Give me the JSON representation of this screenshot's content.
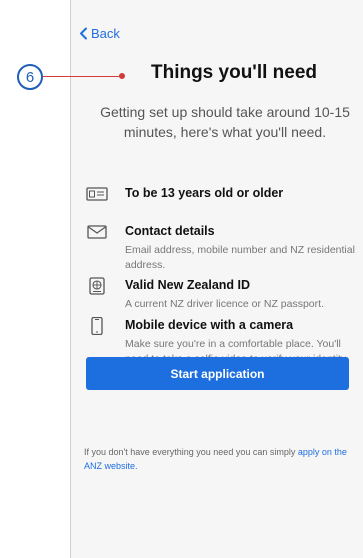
{
  "callout": {
    "number": "6"
  },
  "nav": {
    "back_label": "Back"
  },
  "header": {
    "title": "Things you'll need",
    "subtitle": "Getting set up should take around 10-15 minutes, here's what you'll need."
  },
  "requirements": [
    {
      "icon": "id-card-icon",
      "title": "To be 13 years old or older",
      "description": ""
    },
    {
      "icon": "envelope-icon",
      "title": "Contact details",
      "description": "Email address, mobile number and NZ residential address."
    },
    {
      "icon": "passport-icon",
      "title": "Valid New Zealand ID",
      "description": "A current NZ driver licence or NZ passport."
    },
    {
      "icon": "mobile-phone-icon",
      "title": "Mobile device with a camera",
      "description": "Make sure you're in a comfortable place. You'll need to take a selfie video to verify your identity."
    }
  ],
  "actions": {
    "start_label": "Start application"
  },
  "footer": {
    "text": "If you don't have everything you need you can simply",
    "link_label": "apply on the ANZ website."
  },
  "colors": {
    "accent": "#1d6fe0",
    "callout": "#1f5fb8",
    "callout_line": "#d23b3b"
  }
}
